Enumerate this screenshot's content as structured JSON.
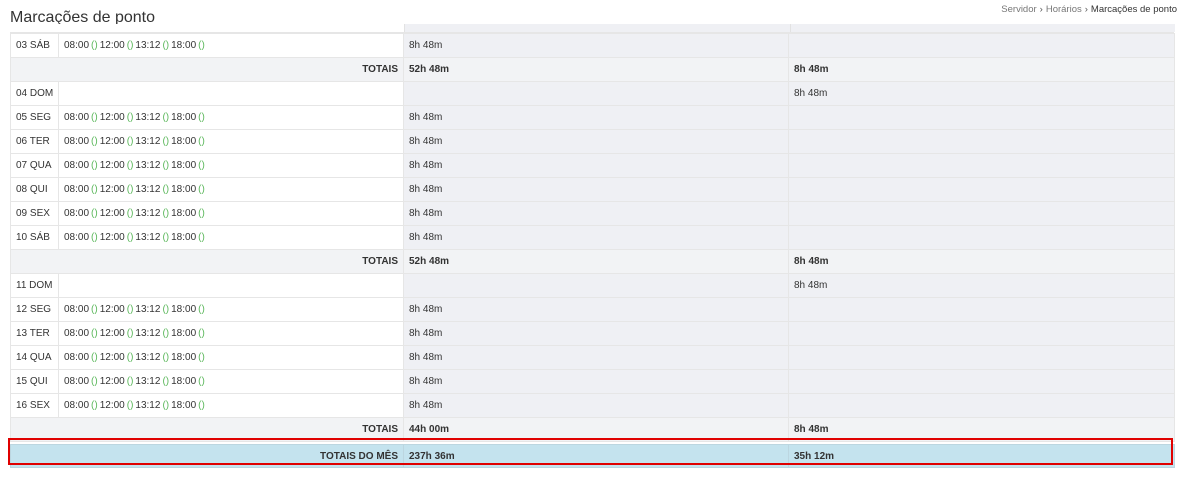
{
  "page": {
    "title": "Marcações de ponto"
  },
  "breadcrumb": [
    {
      "label": "Servidor"
    },
    {
      "label": "Horários"
    },
    {
      "label": "Marcações de ponto"
    }
  ],
  "rows": [
    {
      "type": "day",
      "day": "03 SÁB",
      "marks": [
        "08:00",
        "12:00",
        "13:12",
        "18:00"
      ],
      "worked": "8h 48m",
      "expected": ""
    },
    {
      "type": "totals",
      "label": "TOTAIS",
      "worked": "52h 48m",
      "expected": "8h 48m"
    },
    {
      "type": "day",
      "day": "04 DOM",
      "marks": [],
      "worked": "",
      "expected": "8h 48m"
    },
    {
      "type": "day",
      "day": "05 SEG",
      "marks": [
        "08:00",
        "12:00",
        "13:12",
        "18:00"
      ],
      "worked": "8h 48m",
      "expected": ""
    },
    {
      "type": "day",
      "day": "06 TER",
      "marks": [
        "08:00",
        "12:00",
        "13:12",
        "18:00"
      ],
      "worked": "8h 48m",
      "expected": ""
    },
    {
      "type": "day",
      "day": "07 QUA",
      "marks": [
        "08:00",
        "12:00",
        "13:12",
        "18:00"
      ],
      "worked": "8h 48m",
      "expected": ""
    },
    {
      "type": "day",
      "day": "08 QUI",
      "marks": [
        "08:00",
        "12:00",
        "13:12",
        "18:00"
      ],
      "worked": "8h 48m",
      "expected": ""
    },
    {
      "type": "day",
      "day": "09 SEX",
      "marks": [
        "08:00",
        "12:00",
        "13:12",
        "18:00"
      ],
      "worked": "8h 48m",
      "expected": ""
    },
    {
      "type": "day",
      "day": "10 SÁB",
      "marks": [
        "08:00",
        "12:00",
        "13:12",
        "18:00"
      ],
      "worked": "8h 48m",
      "expected": ""
    },
    {
      "type": "totals",
      "label": "TOTAIS",
      "worked": "52h 48m",
      "expected": "8h 48m"
    },
    {
      "type": "day",
      "day": "11 DOM",
      "marks": [],
      "worked": "",
      "expected": "8h 48m"
    },
    {
      "type": "day",
      "day": "12 SEG",
      "marks": [
        "08:00",
        "12:00",
        "13:12",
        "18:00"
      ],
      "worked": "8h 48m",
      "expected": ""
    },
    {
      "type": "day",
      "day": "13 TER",
      "marks": [
        "08:00",
        "12:00",
        "13:12",
        "18:00"
      ],
      "worked": "8h 48m",
      "expected": ""
    },
    {
      "type": "day",
      "day": "14 QUA",
      "marks": [
        "08:00",
        "12:00",
        "13:12",
        "18:00"
      ],
      "worked": "8h 48m",
      "expected": ""
    },
    {
      "type": "day",
      "day": "15 QUI",
      "marks": [
        "08:00",
        "12:00",
        "13:12",
        "18:00"
      ],
      "worked": "8h 48m",
      "expected": ""
    },
    {
      "type": "day",
      "day": "16 SEX",
      "marks": [
        "08:00",
        "12:00",
        "13:12",
        "18:00"
      ],
      "worked": "8h 48m",
      "expected": ""
    },
    {
      "type": "totals",
      "label": "TOTAIS",
      "worked": "44h 00m",
      "expected": "8h 48m"
    }
  ],
  "month_total": {
    "label": "TOTAIS DO MÊS",
    "worked": "237h 36m",
    "expected": "35h 12m"
  },
  "mark_separator": "()",
  "colors": {
    "accent_green": "#5cb85c",
    "highlight_red": "#e00000",
    "month_total_bg": "#c4e3ee"
  }
}
